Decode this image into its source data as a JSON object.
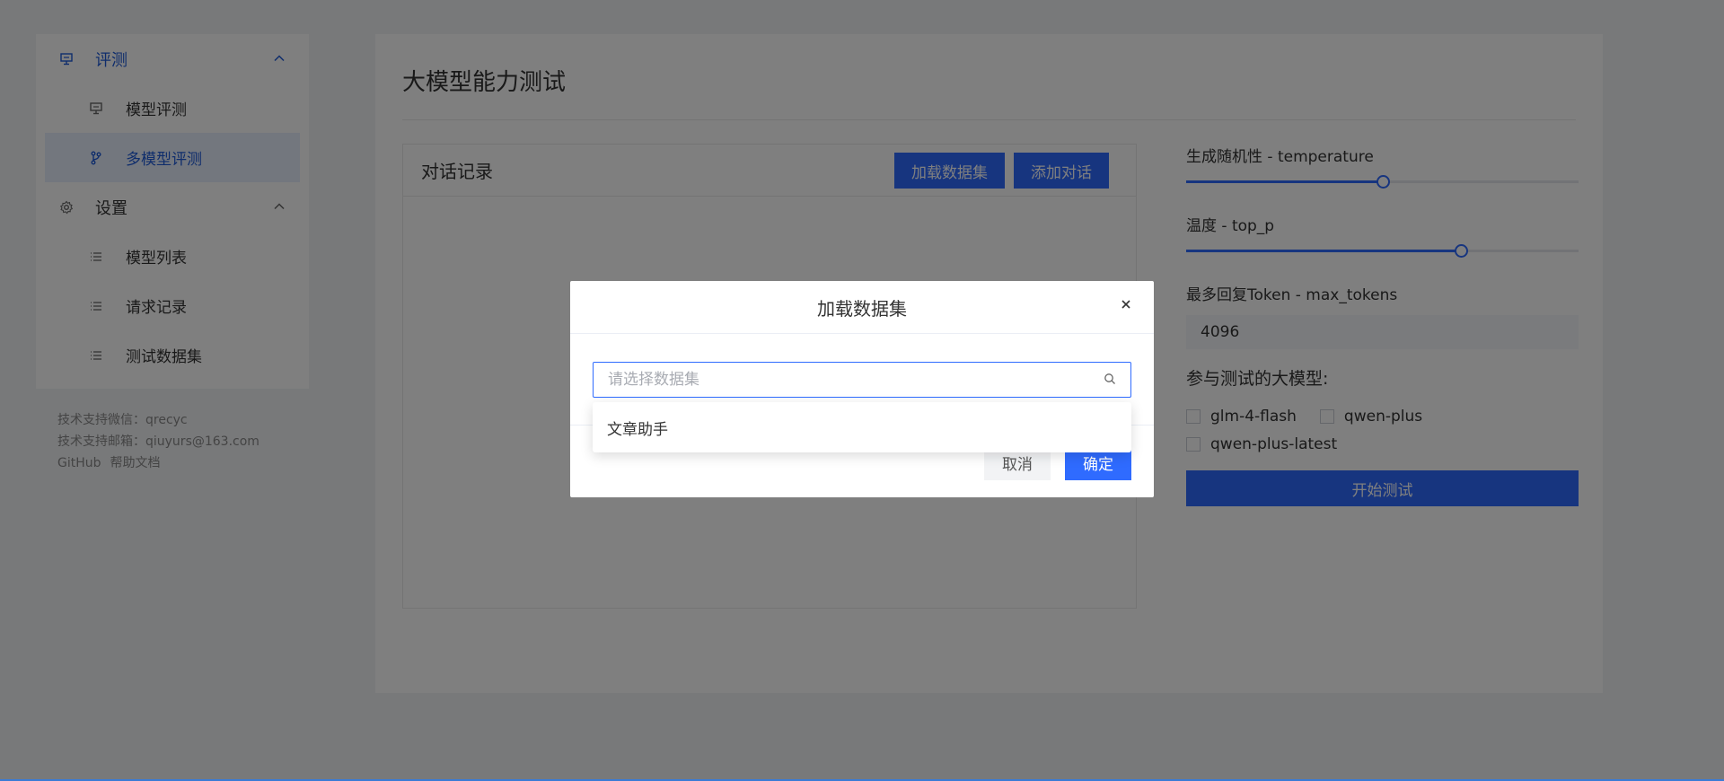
{
  "sidebar": {
    "groups": [
      {
        "label": "评测",
        "items": [
          {
            "label": "模型评测"
          },
          {
            "label": "多模型评测"
          }
        ]
      },
      {
        "label": "设置",
        "items": [
          {
            "label": "模型列表"
          },
          {
            "label": "请求记录"
          },
          {
            "label": "测试数据集"
          }
        ]
      }
    ],
    "footer": {
      "wechat": "技术支持微信：qrecyc",
      "email": "技术支持邮箱：qiuyurs@163.com",
      "github": "GitHub",
      "docs": "帮助文档"
    }
  },
  "main": {
    "title": "大模型能力测试",
    "chat": {
      "title": "对话记录",
      "load_dataset_btn": "加载数据集",
      "add_dialog_btn": "添加对话"
    },
    "params": {
      "temperature_label": "生成随机性 - temperature",
      "temperature_value": 0.5,
      "top_p_label": "温度 - top_p",
      "top_p_value": 0.7,
      "max_tokens_label": "最多回复Token - max_tokens",
      "max_tokens_value": "4096",
      "models_label": "参与测试的大模型:",
      "models": [
        {
          "name": "glm-4-flash",
          "checked": false
        },
        {
          "name": "qwen-plus",
          "checked": false
        },
        {
          "name": "qwen-plus-latest",
          "checked": false
        }
      ],
      "start_btn": "开始测试"
    }
  },
  "dialog": {
    "title": "加载数据集",
    "select_placeholder": "请选择数据集",
    "options": [
      "文章助手"
    ],
    "cancel": "取消",
    "confirm": "确定"
  },
  "colors": {
    "accent": "#2f6bff",
    "active_menu_text": "#1f5bd8",
    "active_menu_bg": "#e6eefc"
  }
}
